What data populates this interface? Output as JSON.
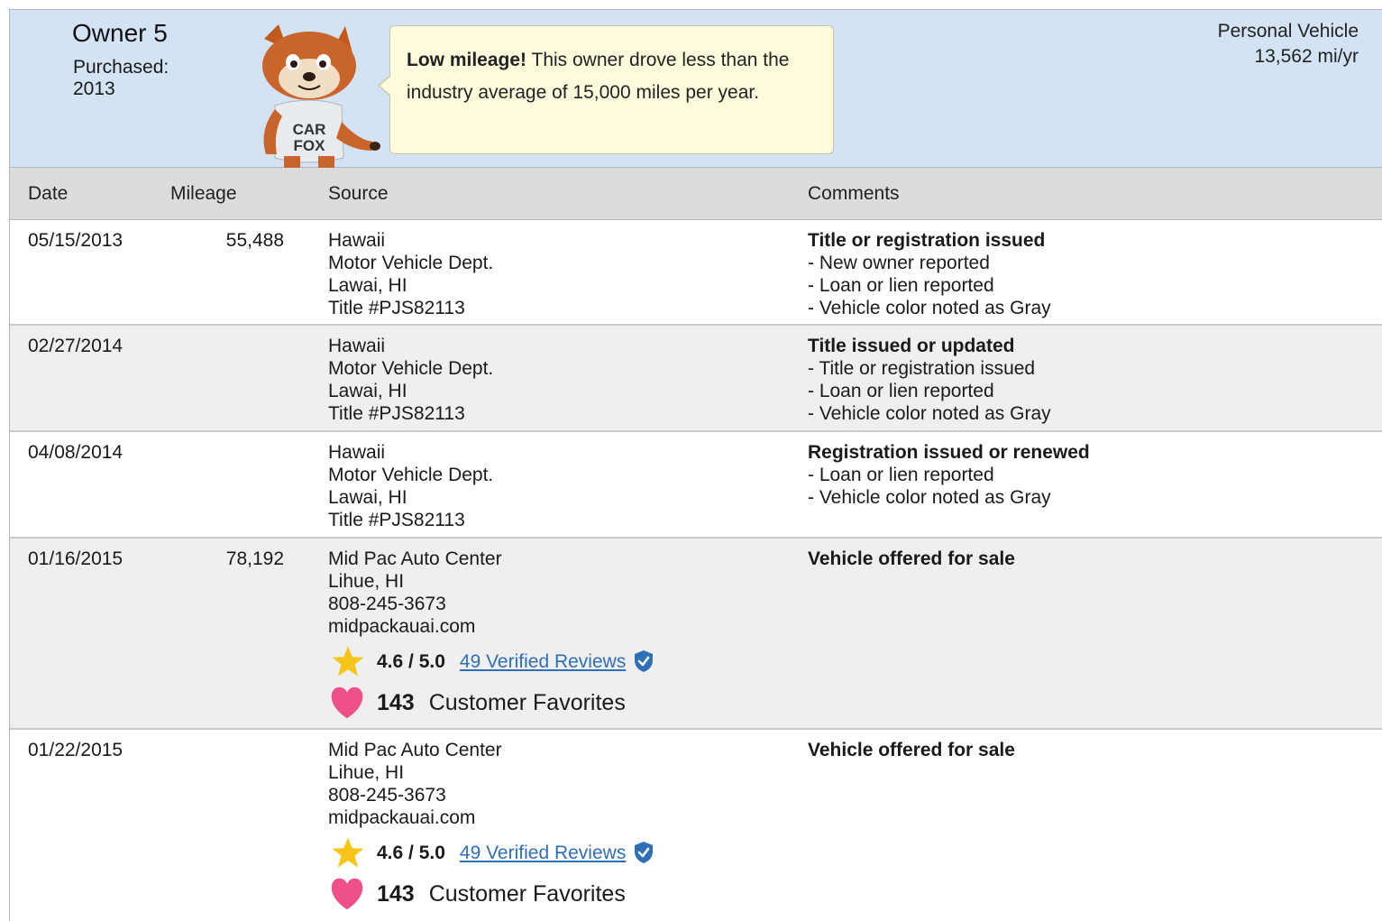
{
  "owner": {
    "title": "Owner 5",
    "purchased_label": "Purchased:",
    "purchased_year": "2013",
    "vehicle_type": "Personal Vehicle",
    "miles_per_year": "13,562 mi/yr",
    "mascot_text": "CAR FOX",
    "bubble_bold": "Low mileage!",
    "bubble_text": " This owner drove less than the industry average of 15,000 miles per year."
  },
  "columns": {
    "date": "Date",
    "mileage": "Mileage",
    "source": "Source",
    "comments": "Comments"
  },
  "rows": [
    {
      "date": "05/15/2013",
      "mileage": "55,488",
      "source": [
        "Hawaii",
        "Motor Vehicle Dept.",
        "Lawai, HI",
        "Title #PJS82113"
      ],
      "comment_head": "Title or registration issued",
      "comment_lines": [
        "- New owner reported",
        "- Loan or lien reported",
        "- Vehicle color noted as Gray"
      ]
    },
    {
      "date": "02/27/2014",
      "mileage": "",
      "source": [
        "Hawaii",
        "Motor Vehicle Dept.",
        "Lawai, HI",
        "Title #PJS82113"
      ],
      "comment_head": "Title issued or updated",
      "comment_lines": [
        "- Title or registration issued",
        "- Loan or lien reported",
        "- Vehicle color noted as Gray"
      ]
    },
    {
      "date": "04/08/2014",
      "mileage": "",
      "source": [
        "Hawaii",
        "Motor Vehicle Dept.",
        "Lawai, HI",
        "Title #PJS82113"
      ],
      "comment_head": "Registration issued or renewed",
      "comment_lines": [
        "- Loan or lien reported",
        "- Vehicle color noted as Gray"
      ]
    },
    {
      "date": "01/16/2015",
      "mileage": "78,192",
      "source": [
        "Mid Pac Auto Center",
        "Lihue, HI",
        "808-245-3673",
        "midpackauai.com"
      ],
      "rating": "4.6 / 5.0",
      "reviews": "49 Verified Reviews",
      "favorites_count": "143",
      "favorites_label": "Customer Favorites",
      "comment_head": "Vehicle offered for sale",
      "comment_lines": []
    },
    {
      "date": "01/22/2015",
      "mileage": "",
      "source": [
        "Mid Pac Auto Center",
        "Lihue, HI",
        "808-245-3673",
        "midpackauai.com"
      ],
      "rating": "4.6 / 5.0",
      "reviews": "49 Verified Reviews",
      "favorites_count": "143",
      "favorites_label": "Customer Favorites",
      "comment_head": "Vehicle offered for sale",
      "comment_lines": []
    }
  ],
  "colors": {
    "header_bg": "#d3e3f4",
    "bubble_bg": "#fffbdd",
    "link": "#2f6fb5",
    "star": "#f5c518",
    "heart": "#ef4f8a",
    "shield": "#2f6fb5"
  },
  "icons": {
    "star": "star-icon",
    "shield": "verified-shield-icon",
    "heart": "heart-icon",
    "mascot": "car-fox-mascot"
  }
}
